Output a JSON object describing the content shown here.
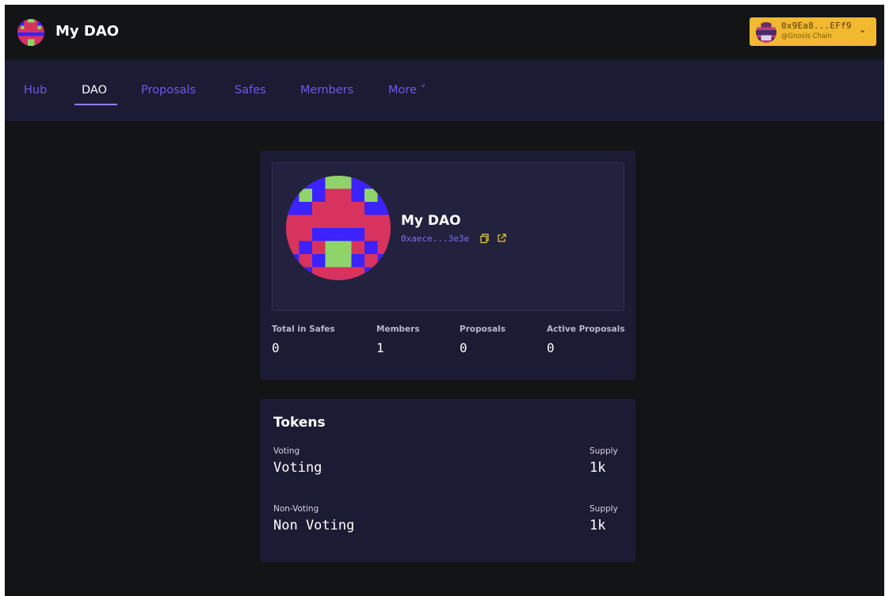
{
  "colors": {
    "background": "#131416",
    "nav_background": "#1c1b34",
    "card_background": "#1c1b34",
    "accent": "#6a5be8",
    "wallet_button": "#f0b930"
  },
  "header": {
    "dao_name": "My DAO",
    "avatar_icon": "dao-avatar-icon",
    "wallet": {
      "address": "0x9Ea8...EFf9",
      "chain": "@Gnosis Chain",
      "icon": "chevron-down-icon"
    }
  },
  "nav": {
    "items": [
      {
        "label": "Hub"
      },
      {
        "label": "DAO",
        "active": true
      },
      {
        "label": "Proposals"
      },
      {
        "label": "Safes"
      },
      {
        "label": "Members"
      },
      {
        "label": "More ˅"
      }
    ]
  },
  "dao_card": {
    "name": "My DAO",
    "address": "0xaece...3e3e",
    "copy_icon": "copy-icon",
    "external_icon": "external-link-icon",
    "stats": [
      {
        "label": "Total in Safes",
        "value": "0"
      },
      {
        "label": "Members",
        "value": "1"
      },
      {
        "label": "Proposals",
        "value": "0"
      },
      {
        "label": "Active Proposals",
        "value": "0"
      }
    ]
  },
  "tokens_card": {
    "title": "Tokens",
    "tokens": [
      {
        "type_label": "Voting",
        "name": "Voting",
        "supply_label": "Supply",
        "supply": "1k"
      },
      {
        "type_label": "Non-Voting",
        "name": "Non Voting",
        "supply_label": "Supply",
        "supply": "1k"
      }
    ]
  }
}
